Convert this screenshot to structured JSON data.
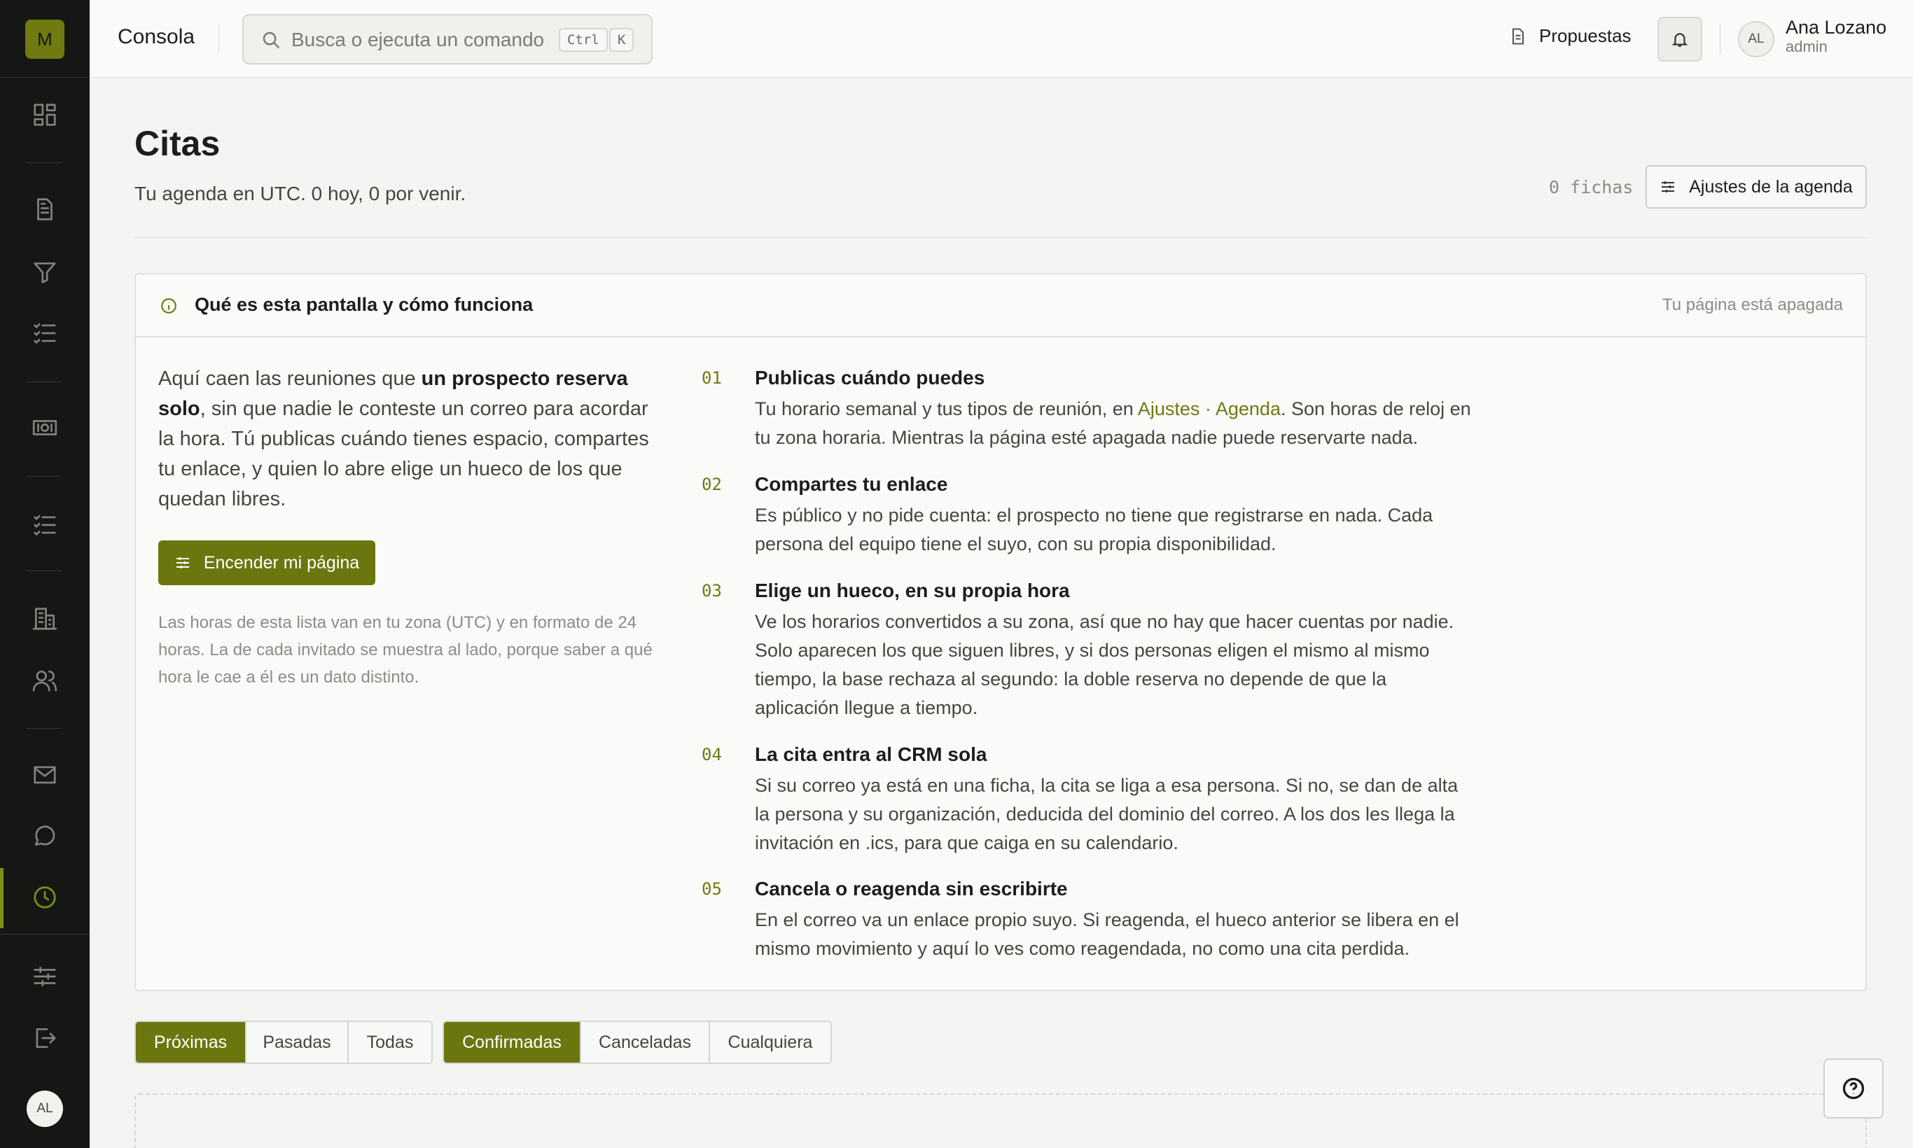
{
  "app": {
    "logo_letter": "M",
    "title": "Consola",
    "accent_color": "#6b760f"
  },
  "search": {
    "placeholder": "Busca o ejecuta un comando",
    "shortcut_key1": "Ctrl",
    "shortcut_key2": "K"
  },
  "topbar": {
    "proposals_label": "Propuestas",
    "user_initials": "AL",
    "user_name": "Ana Lozano",
    "user_role": "admin"
  },
  "sidebar": {
    "icons": [
      "dashboard-icon",
      "document-icon",
      "filter-icon",
      "checklist-icon",
      "money-icon",
      "task-list-icon",
      "building-icon",
      "users-icon",
      "mail-icon",
      "chat-icon",
      "clock-icon",
      "sliders-icon",
      "logout-icon"
    ],
    "active": "clock-icon",
    "avatar_initials": "AL"
  },
  "page": {
    "title": "Citas",
    "subtitle": "Tu agenda en UTC. 0 hoy, 0 por venir.",
    "count_label": "0 fichas",
    "settings_button": "Ajustes de la agenda"
  },
  "info_card": {
    "title": "Qué es esta pantalla y cómo funciona",
    "status": "Tu página está apagada",
    "intro_pre": "Aquí caen las reuniones que ",
    "intro_bold": "un prospecto reserva solo",
    "intro_post": ", sin que nadie le conteste un correo para acordar la hora. Tú publicas cuándo tienes espacio, compartes tu enlace, y quien lo abre elige un hueco de los que quedan libres.",
    "enable_button": "Encender mi página",
    "note": "Las horas de esta lista van en tu zona (UTC) y en formato de 24 horas. La de cada invitado se muestra al lado, porque saber a qué hora le cae a él es un dato distinto.",
    "steps": [
      {
        "num": "01",
        "title": "Publicas cuándo puedes",
        "desc_pre": "Tu horario semanal y tus tipos de reunión, en ",
        "desc_link": "Ajustes · Agenda",
        "desc_post": ". Son horas de reloj en tu zona horaria. Mientras la página esté apagada nadie puede reservarte nada."
      },
      {
        "num": "02",
        "title": "Compartes tu enlace",
        "desc": "Es público y no pide cuenta: el prospecto no tiene que registrarse en nada. Cada persona del equipo tiene el suyo, con su propia disponibilidad."
      },
      {
        "num": "03",
        "title": "Elige un hueco, en su propia hora",
        "desc": "Ve los horarios convertidos a su zona, así que no hay que hacer cuentas por nadie. Solo aparecen los que siguen libres, y si dos personas eligen el mismo al mismo tiempo, la base rechaza al segundo: la doble reserva no depende de que la aplicación llegue a tiempo."
      },
      {
        "num": "04",
        "title": "La cita entra al CRM sola",
        "desc": "Si su correo ya está en una ficha, la cita se liga a esa persona. Si no, se dan de alta la persona y su organización, deducida del dominio del correo. A los dos les llega la invitación en .ics, para que caiga en su calendario."
      },
      {
        "num": "05",
        "title": "Cancela o reagenda sin escribirte",
        "desc": "En el correo va un enlace propio suyo. Si reagenda, el hueco anterior se libera en el mismo movimiento y aquí lo ves como reagendada, no como una cita perdida."
      }
    ]
  },
  "filters": {
    "time": [
      "Próximas",
      "Pasadas",
      "Todas"
    ],
    "time_selected": "Próximas",
    "status": [
      "Confirmadas",
      "Canceladas",
      "Cualquiera"
    ],
    "status_selected": "Confirmadas"
  }
}
